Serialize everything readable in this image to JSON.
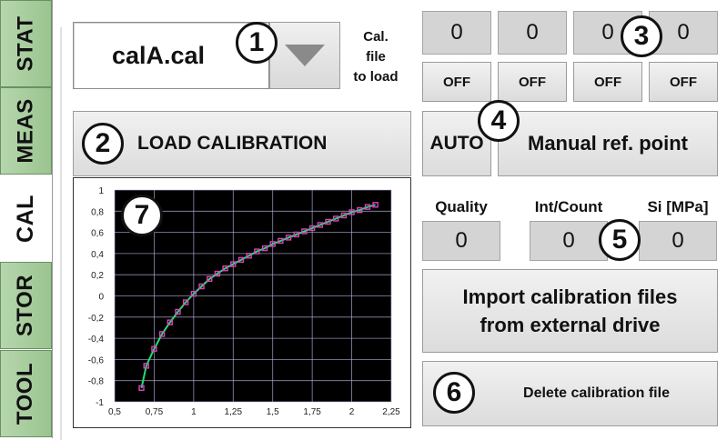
{
  "tabs": [
    {
      "label": "STAT",
      "active": false
    },
    {
      "label": "MEAS",
      "active": false
    },
    {
      "label": "CAL",
      "active": true
    },
    {
      "label": "STOR",
      "active": false
    },
    {
      "label": "TOOL",
      "active": false
    }
  ],
  "cal_file": {
    "value": "calA.cal",
    "caption": "Cal.\nfile\nto load"
  },
  "channels": {
    "values": [
      "0",
      "0",
      "0",
      "0"
    ],
    "toggles": [
      "OFF",
      "OFF",
      "OFF",
      "OFF"
    ]
  },
  "buttons": {
    "load": "LOAD CALIBRATION",
    "auto": "AUTO",
    "manual": "Manual ref. point",
    "import": "Import calibration files\nfrom external drive",
    "delete": "Delete calibration file"
  },
  "readouts": {
    "quality": {
      "label": "Quality",
      "value": "0"
    },
    "int_count": {
      "label": "Int/Count",
      "value": "0"
    },
    "si": {
      "label": "Si [MPa]",
      "value": "0"
    }
  },
  "callouts": [
    "1",
    "2",
    "3",
    "4",
    "5",
    "6",
    "7"
  ],
  "colors": {
    "tab_green": "#a9cf9f",
    "plot_bg": "#000000",
    "grid": "#b8b0e0",
    "curve": "#20e070",
    "marker": "#e040c0"
  },
  "chart_data": {
    "type": "line",
    "title": "",
    "xlabel": "",
    "ylabel": "",
    "xlim": [
      0.5,
      2.25
    ],
    "ylim": [
      -1,
      1
    ],
    "x_ticks": [
      "0,5",
      "0,75",
      "1",
      "1,25",
      "1,5",
      "1,75",
      "2",
      "2,25"
    ],
    "y_ticks": [
      "1",
      "0,8",
      "0,6",
      "0,4",
      "0,2",
      "0",
      "-0,2",
      "-0,4",
      "-0,6",
      "-0,8",
      "-1"
    ],
    "grid": true,
    "series": [
      {
        "x": [
          0.67,
          0.7,
          0.75,
          0.8,
          0.85,
          0.9,
          0.95,
          1.0,
          1.05,
          1.1,
          1.15,
          1.2,
          1.25,
          1.3,
          1.35,
          1.4,
          1.45,
          1.5,
          1.55,
          1.6,
          1.65,
          1.7,
          1.75,
          1.8,
          1.85,
          1.9,
          1.95,
          2.0,
          2.05,
          2.1,
          2.15
        ],
        "y": [
          -0.87,
          -0.66,
          -0.5,
          -0.36,
          -0.25,
          -0.15,
          -0.06,
          0.02,
          0.09,
          0.16,
          0.21,
          0.26,
          0.3,
          0.34,
          0.38,
          0.42,
          0.45,
          0.49,
          0.52,
          0.55,
          0.58,
          0.61,
          0.64,
          0.67,
          0.7,
          0.73,
          0.76,
          0.79,
          0.81,
          0.84,
          0.86
        ]
      }
    ]
  }
}
